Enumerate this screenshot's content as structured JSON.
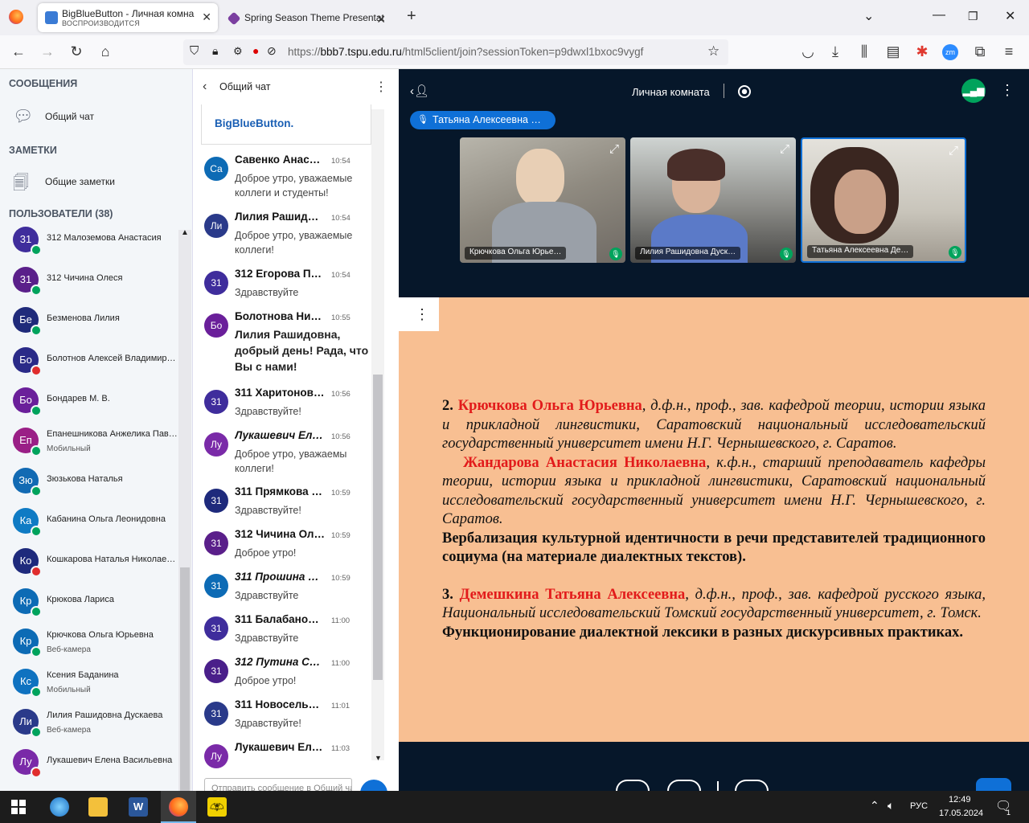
{
  "browser": {
    "tabs": [
      {
        "title": "BigBlueButton - Личная комна",
        "subtitle": "ВОСПРОИЗВОДИТСЯ",
        "active": true
      },
      {
        "title": "Spring Season Theme Presentat",
        "active": false
      }
    ],
    "url_prefix": "https://",
    "url_host": "bbb7.tspu.edu.ru",
    "url_path": "/html5client/join?sessionToken=p9dwxl1bxoc9vygf"
  },
  "sidebar": {
    "messages_heading": "СООБЩЕНИЯ",
    "public_chat": "Общий чат",
    "notes_heading": "ЗАМЕТКИ",
    "shared_notes": "Общие заметки",
    "users_heading": "ПОЛЬЗОВАТЕЛИ (38)",
    "users": [
      {
        "initials": "31",
        "name": "312 Малоземова Анастасия",
        "sub": "",
        "color": "#3f2d9c",
        "badge": "#00a35c"
      },
      {
        "initials": "31",
        "name": "312 Чичина Олеся",
        "sub": "",
        "color": "#5a1f8a",
        "badge": "#00a35c"
      },
      {
        "initials": "Бе",
        "name": "Безменова Лилия",
        "sub": "",
        "color": "#1f2a7a",
        "badge": "#00a35c"
      },
      {
        "initials": "Бо",
        "name": "Болотнов Алексей Владимиро…",
        "sub": "",
        "color": "#2a2a88",
        "badge": "#e02d2d"
      },
      {
        "initials": "Бо",
        "name": "Бондарев М. В.",
        "sub": "",
        "color": "#6a1f9a",
        "badge": "#00a35c"
      },
      {
        "initials": "Еп",
        "name": "Епанешникова Анжелика Пав…",
        "sub": "Мобильный",
        "color": "#9a1f86",
        "badge": "#00a35c"
      },
      {
        "initials": "Зю",
        "name": "Зюзькова Наталья",
        "sub": "",
        "color": "#126ab3",
        "badge": "#00a35c"
      },
      {
        "initials": "Ка",
        "name": "Кабанина Ольга Леонидовна",
        "sub": "",
        "color": "#0f7bc4",
        "badge": "#00a35c"
      },
      {
        "initials": "Ко",
        "name": "Кошкарова Наталья Николаев…",
        "sub": "",
        "color": "#1e2a7c",
        "badge": "#e02d2d"
      },
      {
        "initials": "Кр",
        "name": "Крюкова Лариса",
        "sub": "",
        "color": "#0d6bb5",
        "badge": "#00a35c"
      },
      {
        "initials": "Кр",
        "name": "Крючкова Ольга Юрьевна",
        "sub": "Веб-камера",
        "color": "#0d6bb5",
        "badge": "#00a35c"
      },
      {
        "initials": "Кс",
        "name": "Ксения Баданина",
        "sub": "Мобильный",
        "color": "#0f72c0",
        "badge": "#00a35c"
      },
      {
        "initials": "Ли",
        "name": "Лилия Рашидовна Дускаева",
        "sub": "Веб-камера",
        "color": "#2a3a8a",
        "badge": "#00a35c"
      },
      {
        "initials": "Лу",
        "name": "Лукашевич Елена Васильевна",
        "sub": "",
        "color": "#7a2aa8",
        "badge": "#e02d2d"
      }
    ]
  },
  "chat": {
    "title": "Общий чат",
    "welcome_tail": "BigBlueButton.",
    "input_placeholder": "Отправить сообщение в Общий чат",
    "messages": [
      {
        "initials": "Са",
        "color": "#0d6bb5",
        "name": "Савенко Анас…",
        "time": "10:54",
        "text": "Доброе утро, уважаемые коллеги и студенты!",
        "italic": false,
        "big": false
      },
      {
        "initials": "Ли",
        "color": "#2a3a8a",
        "name": "Лилия Рашид…",
        "time": "10:54",
        "text": "Доброе утро, уважаемые коллеги!",
        "italic": false,
        "big": false
      },
      {
        "initials": "31",
        "color": "#3f2d9c",
        "name": "312 Егорова П…",
        "time": "10:54",
        "text": "Здравствуйте",
        "italic": false,
        "big": false
      },
      {
        "initials": "Бо",
        "color": "#6a1f9a",
        "name": "Болотнова Ни…",
        "time": "10:55",
        "text": "Лилия Рашидовна, добрый день! Рада, что Вы с нами!",
        "italic": false,
        "big": true
      },
      {
        "initials": "31",
        "color": "#3f2d9c",
        "name": "311 Харитонов…",
        "time": "10:56",
        "text": "Здравствуйте!",
        "italic": false,
        "big": false
      },
      {
        "initials": "Лу",
        "color": "#7a2aa8",
        "name": "Лукашевич Ел…",
        "time": "10:56",
        "text": "Доброе утро, уважаемы коллеги!",
        "italic": true,
        "big": false
      },
      {
        "initials": "31",
        "color": "#1e2a7c",
        "name": "311 Прямкова …",
        "time": "10:59",
        "text": "Здравствуйте!",
        "italic": false,
        "big": false
      },
      {
        "initials": "31",
        "color": "#5a1f8a",
        "name": "312 Чичина Ол…",
        "time": "10:59",
        "text": "Доброе утро!",
        "italic": false,
        "big": false
      },
      {
        "initials": "31",
        "color": "#0d6bb5",
        "name": "311 Прошина П…",
        "time": "10:59",
        "text": "Здравствуйте",
        "italic": true,
        "big": false
      },
      {
        "initials": "31",
        "color": "#3f2d9c",
        "name": "311 Балабано…",
        "time": "11:00",
        "text": "Здравствуйте",
        "italic": false,
        "big": false
      },
      {
        "initials": "31",
        "color": "#4a1f8a",
        "name": "312 Путина Со…",
        "time": "11:00",
        "text": "Доброе утро!",
        "italic": true,
        "big": false
      },
      {
        "initials": "31",
        "color": "#2a3a8a",
        "name": "311 Новосель…",
        "time": "11:01",
        "text": "Здравствуйте!",
        "italic": false,
        "big": false
      },
      {
        "initials": "Лу",
        "color": "#7a2aa8",
        "name": "Лукашевич Ел…",
        "time": "11:03",
        "text": "",
        "italic": false,
        "big": false
      }
    ]
  },
  "main": {
    "room_title": "Личная комната",
    "talking_indicator": "Татьяна Алексеевна …",
    "videos": [
      {
        "label": "Крючкова Ольга Юрье…"
      },
      {
        "label": "Лилия Рашидовна Дуск…"
      },
      {
        "label": "Татьяна Алексеевна Де…"
      }
    ]
  },
  "slide": {
    "p2_num": "2. ",
    "p2_name": "Крючкова Ольга Юрьевна",
    "p2_rest": ", д.ф.н., проф., зав. кафедрой теории, истории языка и прикладной лингвистики, Саратовский национальный исследовательский государственный университет имени Н.Г. Чернышевского, г. Саратов.",
    "p2b_name": "Жандарова Анастасия Николаевна",
    "p2b_rest": ", к.ф.н., старший преподаватель кафедры теории, истории языка и прикладной лингвистики, Саратовский национальный исследовательский государственный университет имени Н.Г. Чернышевского, г. Саратов.",
    "p2_title": "Вербализация культурной идентичности в речи представителей традиционного социума (на материале диалектных текстов).",
    "p3_num": "3. ",
    "p3_name": "Демешкина Татьяна Алексеевна",
    "p3_rest": ", д.ф.н., проф., зав. кафедрой русского языка, Национальный исследовательский Томский государственный университет, г. Томск.",
    "p3_title": "Функционирование диалектной лексики в разных дискурсивных практиках."
  },
  "taskbar": {
    "lang": "РУС",
    "time": "12:49",
    "date": "17.05.2024",
    "notif_count": "1"
  }
}
